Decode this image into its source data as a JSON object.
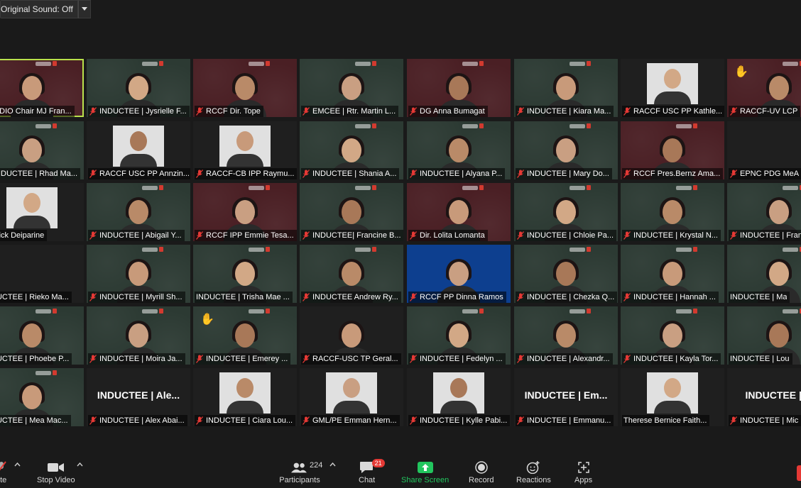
{
  "topbar": {
    "original_sound": "Original Sound: Off"
  },
  "tiles": [
    {
      "label": "MDIO Chair MJ Fran...",
      "bg": "maroon",
      "active": true
    },
    {
      "label": "INDUCTEE | Jysrielle F...",
      "bg": "green"
    },
    {
      "label": "RCCF Dir. Tope",
      "bg": "maroon"
    },
    {
      "label": "EMCEE | Rtr. Martin L...",
      "bg": "green"
    },
    {
      "label": "DG Anna Bumagat",
      "bg": "maroon"
    },
    {
      "label": "INDUCTEE | Kiara Ma...",
      "bg": "green"
    },
    {
      "label": "RACCF USC PP Kathle...",
      "bg": "dark",
      "photo": true
    },
    {
      "label": "RACCF-UV LCP",
      "bg": "maroon",
      "wave": true
    },
    {
      "label": "INDUCTEE | Rhad Ma...",
      "bg": "green"
    },
    {
      "label": "RACCF USC PP Annzin...",
      "bg": "dark",
      "photo": true
    },
    {
      "label": "RACCF-CB IPP Raymu...",
      "bg": "dark",
      "photo": true
    },
    {
      "label": "INDUCTEE | Shania A...",
      "bg": "green"
    },
    {
      "label": "INDUCTEE | Alyana P...",
      "bg": "green"
    },
    {
      "label": "INDUCTEE | Mary Do...",
      "bg": "green"
    },
    {
      "label": "RCCF Pres.Bernz Ama...",
      "bg": "maroon"
    },
    {
      "label": "EPNC PDG MeA",
      "bg": "dark",
      "noperson": true
    },
    {
      "label": "Sydrick Deiparine",
      "bg": "dark",
      "photo": true,
      "nomic": true
    },
    {
      "label": "INDUCTEE | Abigail Y...",
      "bg": "green"
    },
    {
      "label": "RCCF IPP Emmie Tesa...",
      "bg": "maroon"
    },
    {
      "label": "INDUCTEE| Francine B...",
      "bg": "green"
    },
    {
      "label": "Dir. Lolita Lomanta",
      "bg": "maroon"
    },
    {
      "label": "INDUCTEE | Chloie Pa...",
      "bg": "green"
    },
    {
      "label": "INDUCTEE | Krystal N...",
      "bg": "green"
    },
    {
      "label": "INDUCTEE | Fran",
      "bg": "green"
    },
    {
      "label": "INDUCTEE | Rieko Ma...",
      "bg": "dark",
      "noperson": true,
      "nomic": true
    },
    {
      "label": "INDUCTEE | Myrill Sh...",
      "bg": "green"
    },
    {
      "label": "INDUCTEE | Trisha Mae ...",
      "bg": "green",
      "nomic": true
    },
    {
      "label": "INDUCTEE Andrew Ry...",
      "bg": "green"
    },
    {
      "label": "RCCF PP Dinna Ramos",
      "bg": "blue"
    },
    {
      "label": "INDUCTEE | Chezka Q...",
      "bg": "green"
    },
    {
      "label": "INDUCTEE | Hannah ...",
      "bg": "green"
    },
    {
      "label": "INDUCTEE | Ma",
      "bg": "green",
      "nomic": true
    },
    {
      "label": "INDUCTEE | Phoebe P...",
      "bg": "green",
      "nomic": true
    },
    {
      "label": "INDUCTEE | Moira Ja...",
      "bg": "green"
    },
    {
      "label": "INDUCTEE | Emerey ...",
      "bg": "green",
      "wave": true
    },
    {
      "label": "RACCF-USC TP Geral...",
      "bg": "dark"
    },
    {
      "label": "INDUCTEE | Fedelyn ...",
      "bg": "green"
    },
    {
      "label": "INDUCTEE | Alexandr...",
      "bg": "green"
    },
    {
      "label": "INDUCTEE | Kayla Tor...",
      "bg": "green"
    },
    {
      "label": "INDUCTEE | Lou",
      "bg": "green",
      "nomic": true
    },
    {
      "label": "INDUCTEE | Mea Mac...",
      "bg": "green",
      "nomic": true
    },
    {
      "label": "INDUCTEE | Alex Abai...",
      "bg": "dark",
      "big": "INDUCTEE | Ale..."
    },
    {
      "label": "INDUCTEE | Ciara Lou...",
      "bg": "dark",
      "photo": true
    },
    {
      "label": "GML/PE Emman Hern...",
      "bg": "dark",
      "photo": true
    },
    {
      "label": "INDUCTEE | Kylle Pabi...",
      "bg": "dark",
      "photo": true
    },
    {
      "label": "INDUCTEE | Emmanu...",
      "bg": "dark",
      "big": "INDUCTEE | Em..."
    },
    {
      "label": "Therese Bernice Faith...",
      "bg": "dark",
      "photo": true,
      "nomic": true
    },
    {
      "label": "INDUCTEE | Mic",
      "bg": "dark",
      "big": "INDUCTEE | M"
    }
  ],
  "toolbar": {
    "mute_label": "ute",
    "video_label": "Stop Video",
    "participants_label": "Participants",
    "participants_count": "224",
    "chat_label": "Chat",
    "chat_badge": "21",
    "share_label": "Share Screen",
    "record_label": "Record",
    "reactions_label": "Reactions",
    "apps_label": "Apps"
  },
  "colors": {
    "share_green": "#22c55e",
    "active_border": "#b9e14a",
    "mute_red": "#e53935"
  }
}
